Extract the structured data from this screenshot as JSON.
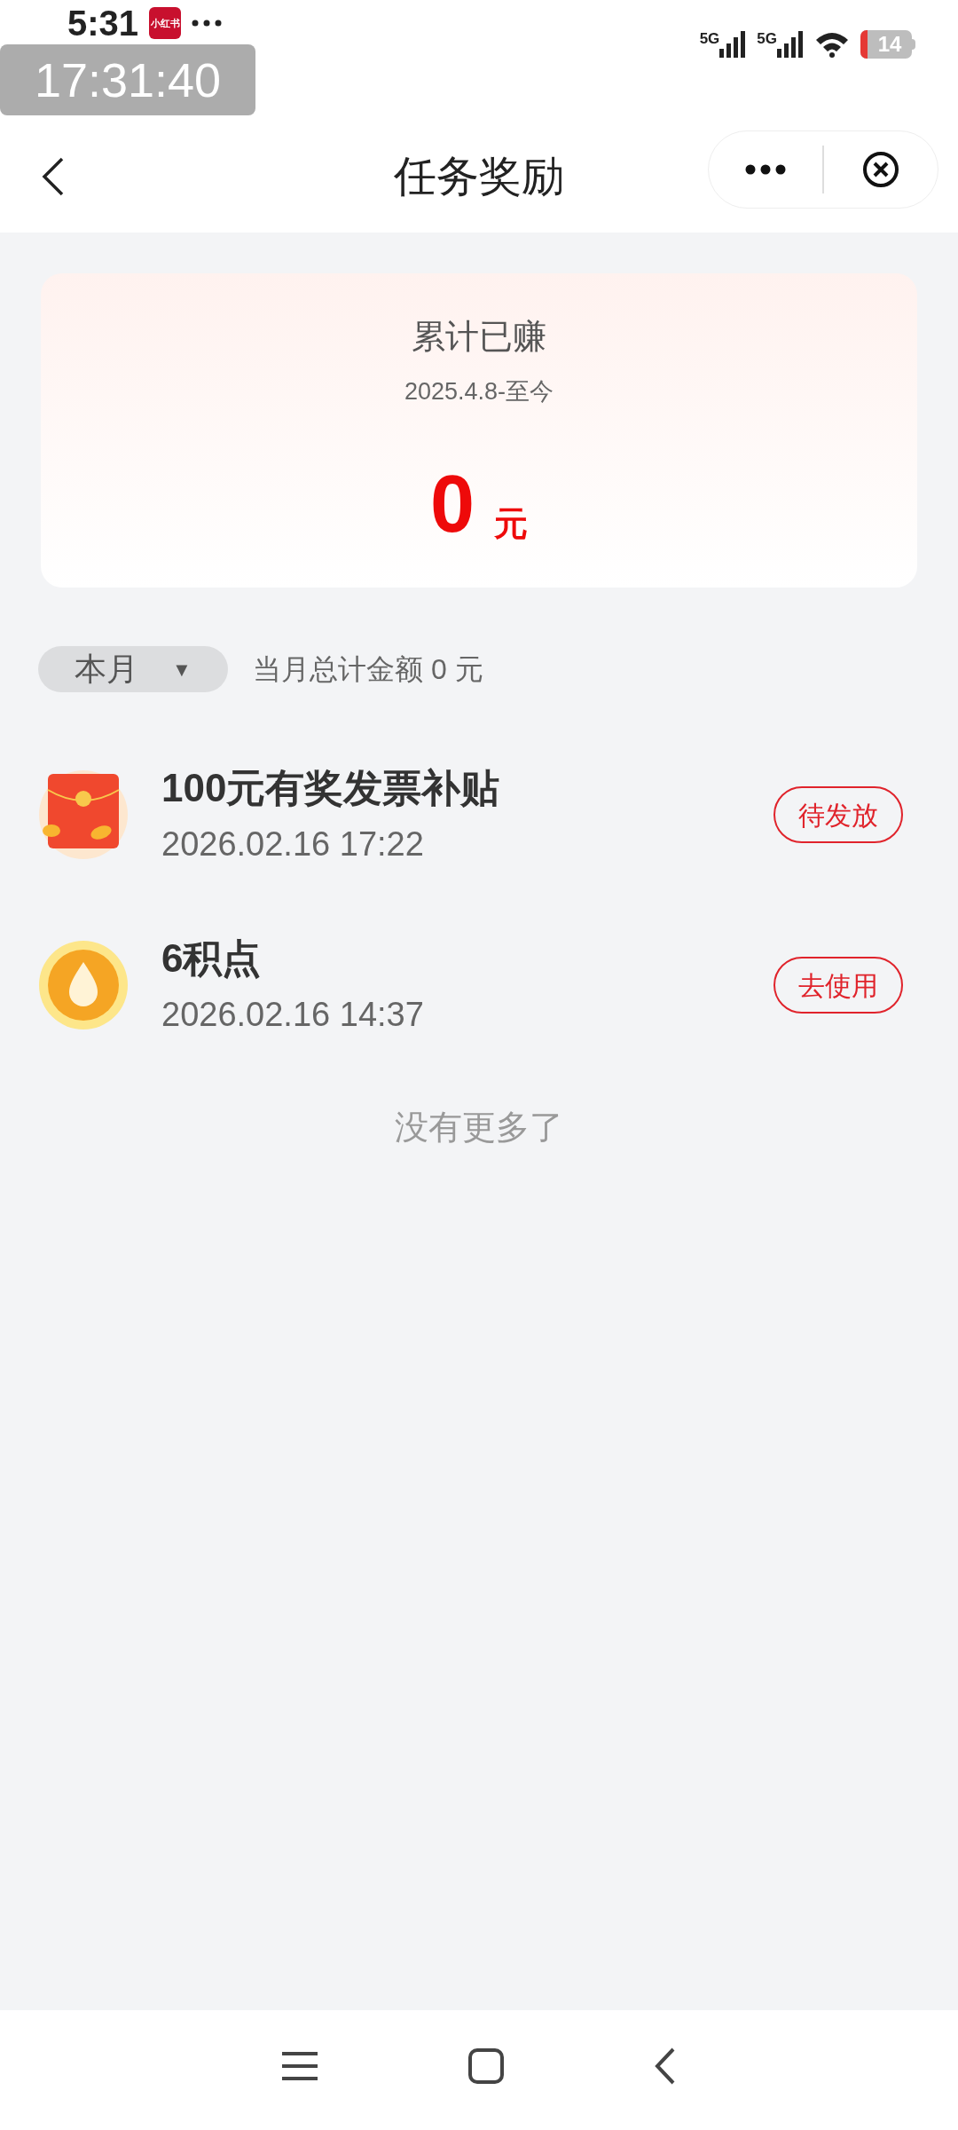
{
  "status_bar": {
    "time": "5:31",
    "app_badge": "小红书",
    "overlay_clock": "17:31:40",
    "network_1": "5G",
    "network_2": "5G",
    "battery": "14"
  },
  "header": {
    "title": "任务奖励"
  },
  "summary": {
    "title": "累计已赚",
    "period": "2025.4.8-至今",
    "amount": "0",
    "unit": "元"
  },
  "filter": {
    "label": "本月",
    "caret": "▼",
    "total_text": "当月总计金额 0 元"
  },
  "rewards": [
    {
      "kind": "red_packet",
      "title": "100元有奖发票补贴",
      "time": "2026.02.16 17:22",
      "action": "待发放"
    },
    {
      "kind": "points",
      "title": "6积点",
      "time": "2026.02.16 14:37",
      "action": "去使用"
    }
  ],
  "footer_note": "没有更多了"
}
